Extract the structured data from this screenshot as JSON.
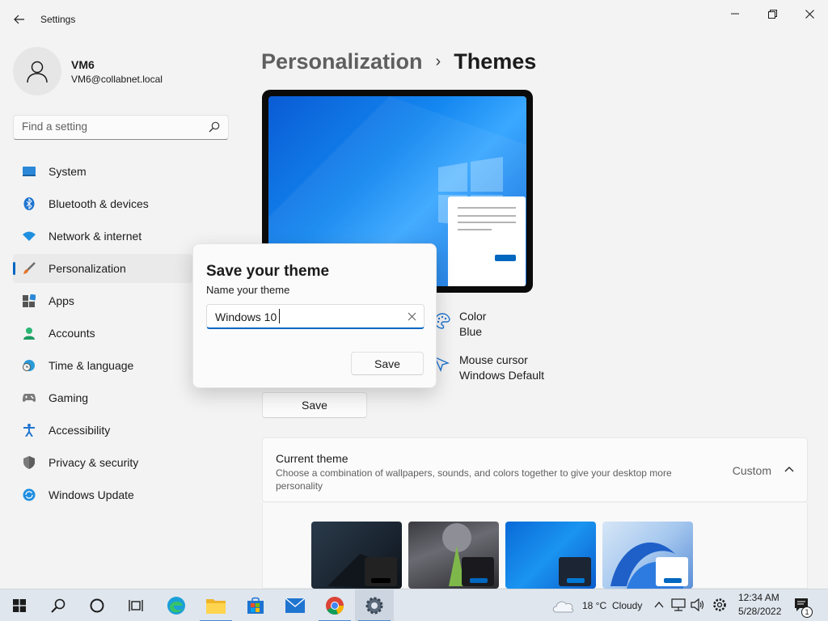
{
  "window": {
    "app_title": "Settings",
    "controls": [
      "minimize",
      "restore",
      "close"
    ]
  },
  "profile": {
    "name": "VM6",
    "email": "VM6@collabnet.local"
  },
  "search": {
    "placeholder": "Find a setting"
  },
  "sidebar": {
    "items": [
      {
        "label": "System",
        "icon": "system-icon"
      },
      {
        "label": "Bluetooth & devices",
        "icon": "bluetooth-icon"
      },
      {
        "label": "Network & internet",
        "icon": "wifi-icon"
      },
      {
        "label": "Personalization",
        "icon": "brush-icon",
        "active": true
      },
      {
        "label": "Apps",
        "icon": "apps-icon"
      },
      {
        "label": "Accounts",
        "icon": "person-icon"
      },
      {
        "label": "Time & language",
        "icon": "clock-globe-icon"
      },
      {
        "label": "Gaming",
        "icon": "gamepad-icon"
      },
      {
        "label": "Accessibility",
        "icon": "accessibility-icon"
      },
      {
        "label": "Privacy & security",
        "icon": "shield-icon"
      },
      {
        "label": "Windows Update",
        "icon": "update-icon"
      }
    ]
  },
  "breadcrumb": {
    "parent": "Personalization",
    "separator": "›",
    "current": "Themes"
  },
  "theme_props": {
    "color_label": "Color",
    "color_value": "Blue",
    "cursor_label": "Mouse cursor",
    "cursor_value": "Windows Default"
  },
  "main": {
    "save_label": "Save"
  },
  "current_theme": {
    "title": "Current theme",
    "description": "Choose a combination of wallpapers, sounds, and colors together to give your desktop more personality",
    "value": "Custom"
  },
  "dialog": {
    "title": "Save your theme",
    "label": "Name your theme",
    "input_value": "Windows 10",
    "save_label": "Save"
  },
  "taskbar": {
    "weather_temp": "18 °C",
    "weather_text": "Cloudy",
    "time": "12:34 AM",
    "date": "5/28/2022",
    "notification_count": "1"
  },
  "colors": {
    "accent": "#0067c0",
    "window_bg": "#f3f3f3",
    "taskbar_bg": "#dfe6ee"
  }
}
